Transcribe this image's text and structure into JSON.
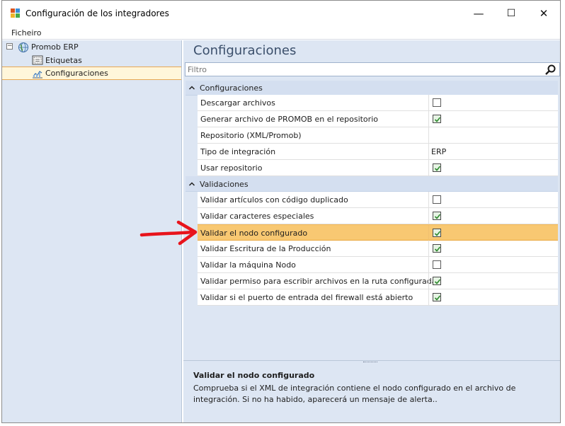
{
  "window": {
    "title": "Configuración de los integradores",
    "minimize_glyph": "—",
    "maximize_glyph": "☐",
    "close_glyph": "✕"
  },
  "menu": {
    "file": "Ficheiro"
  },
  "tree": {
    "toggle_glyph": "−",
    "root": {
      "label": "Promob ERP",
      "icon": "globe-icon"
    },
    "children": [
      {
        "label": "Etiquetas",
        "icon": "label-grid-icon"
      },
      {
        "label": "Configuraciones",
        "icon": "config-chart-icon",
        "selected": true
      }
    ]
  },
  "panel": {
    "title": "Configuraciones",
    "filter_placeholder": "Filtro"
  },
  "categories": [
    {
      "label": "Configuraciones",
      "rows": [
        {
          "name": "Descargar archivos",
          "type": "checkbox",
          "checked": false
        },
        {
          "name": "Generar archivo de PROMOB en el repositorio",
          "type": "checkbox",
          "checked": true
        },
        {
          "name": "Repositorio (XML/Promob)",
          "type": "text",
          "value": ""
        },
        {
          "name": "Tipo de integración",
          "type": "text",
          "value": "ERP"
        },
        {
          "name": "Usar repositorio",
          "type": "checkbox",
          "checked": true
        }
      ]
    },
    {
      "label": "Validaciones",
      "rows": [
        {
          "name": "Validar artículos con código duplicado",
          "type": "checkbox",
          "checked": false
        },
        {
          "name": "Validar caracteres especiales",
          "type": "checkbox",
          "checked": true
        },
        {
          "name": "Validar el nodo configurado",
          "type": "checkbox",
          "checked": true,
          "selected": true
        },
        {
          "name": "Validar Escritura de la Producción",
          "type": "checkbox",
          "checked": true
        },
        {
          "name": "Validar la máquina Nodo",
          "type": "checkbox",
          "checked": false
        },
        {
          "name": "Validar permiso para escribir archivos en la ruta configurada",
          "type": "checkbox",
          "checked": true
        },
        {
          "name": "Validar si el puerto de entrada del firewall está abierto",
          "type": "checkbox",
          "checked": true
        }
      ]
    }
  ],
  "description": {
    "title": "Validar el nodo configurado",
    "text": "Comprueba si el XML de integración contiene el nodo configurado en el archivo de integración. Si no ha habido, aparecerá un mensaje de alerta.."
  },
  "colors": {
    "pane_bg": "#dde6f3",
    "category_bg": "#d4dff0",
    "selected_row": "#f8c872",
    "tree_selection": "#fff6da",
    "annotation_arrow": "#e8141c",
    "checkmark": "#2f8a2f"
  }
}
